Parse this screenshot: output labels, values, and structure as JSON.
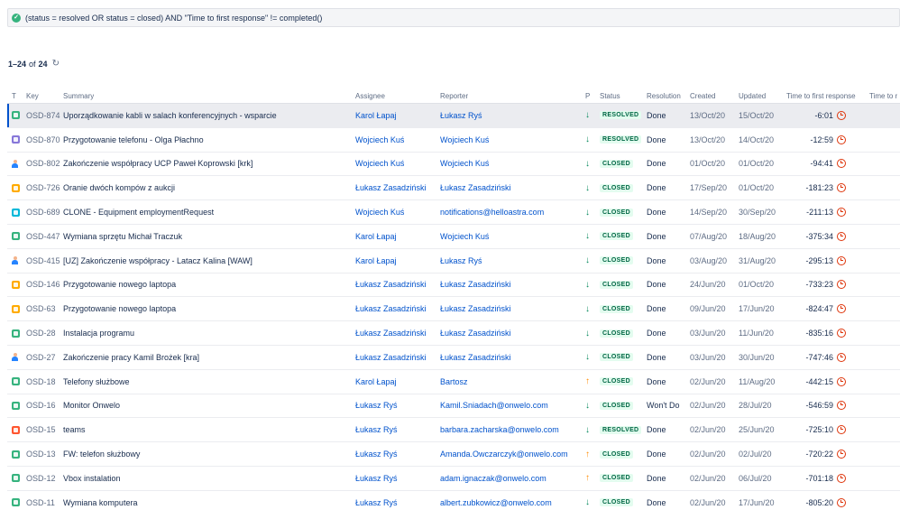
{
  "jql": {
    "query": "(status = resolved OR status = closed) AND \"Time to first response\" != completed()"
  },
  "results": {
    "range": "1–24",
    "of_label": "of",
    "total": "24"
  },
  "columns": [
    {
      "key": "t",
      "label": "T"
    },
    {
      "key": "key",
      "label": "Key"
    },
    {
      "key": "summary",
      "label": "Summary"
    },
    {
      "key": "assignee",
      "label": "Assignee"
    },
    {
      "key": "reporter",
      "label": "Reporter"
    },
    {
      "key": "p",
      "label": "P"
    },
    {
      "key": "status",
      "label": "Status"
    },
    {
      "key": "resolution",
      "label": "Resolution"
    },
    {
      "key": "created",
      "label": "Created"
    },
    {
      "key": "updated",
      "label": "Updated"
    },
    {
      "key": "ttfr",
      "label": "Time to first response"
    },
    {
      "key": "ttr",
      "label": "Time to r"
    }
  ],
  "colors": {
    "accent": "#0052cc",
    "resolved_bg": "#e3fcef",
    "resolved_text": "#006644",
    "priority_low": "#00875a",
    "priority_high": "#ff8b00",
    "sla_breached": "#de350b"
  },
  "rows": [
    {
      "type": "square",
      "type_color": "#36b37e",
      "key": "OSD-874",
      "summary": "Uporządkowanie kabli w salach konferencyjnych - wsparcie",
      "assignee": "Karol Łapaj",
      "reporter": "Łukasz Ryś",
      "priority": "low",
      "priority_glyph": "↓",
      "status": "RESOLVED",
      "resolution": "Done",
      "created": "13/Oct/20",
      "updated": "15/Oct/20",
      "ttfr": "-6:01"
    },
    {
      "type": "square",
      "type_color": "#8777d9",
      "key": "OSD-870",
      "summary": "Przygotowanie telefonu - Olga Płachno",
      "assignee": "Wojciech Kuś",
      "reporter": "Wojciech Kuś",
      "priority": "low",
      "priority_glyph": "↓",
      "status": "RESOLVED",
      "resolution": "Done",
      "created": "13/Oct/20",
      "updated": "14/Oct/20",
      "ttfr": "-12:59"
    },
    {
      "type": "person",
      "type_color": "#2684ff",
      "key": "OSD-802",
      "summary": "Zakończenie współpracy UCP Paweł Koprowski [krk]",
      "assignee": "Wojciech Kuś",
      "reporter": "Wojciech Kuś",
      "priority": "low",
      "priority_glyph": "↓",
      "status": "CLOSED",
      "resolution": "Done",
      "created": "01/Oct/20",
      "updated": "01/Oct/20",
      "ttfr": "-94:41"
    },
    {
      "type": "square",
      "type_color": "#ffab00",
      "key": "OSD-726",
      "summary": "Oranie dwóch kompów z aukcji",
      "assignee": "Łukasz Zasadziński",
      "reporter": "Łukasz Zasadziński",
      "priority": "low",
      "priority_glyph": "↓",
      "status": "CLOSED",
      "resolution": "Done",
      "created": "17/Sep/20",
      "updated": "01/Oct/20",
      "ttfr": "-181:23"
    },
    {
      "type": "square",
      "type_color": "#00b8d9",
      "key": "OSD-689",
      "summary": "CLONE - Equipment employmentRequest",
      "assignee": "Wojciech Kuś",
      "reporter": "notifications@helloastra.com",
      "priority": "low",
      "priority_glyph": "↓",
      "status": "CLOSED",
      "resolution": "Done",
      "created": "14/Sep/20",
      "updated": "30/Sep/20",
      "ttfr": "-211:13"
    },
    {
      "type": "square",
      "type_color": "#36b37e",
      "key": "OSD-447",
      "summary": "Wymiana sprzętu Michał Traczuk",
      "assignee": "Karol Łapaj",
      "reporter": "Wojciech Kuś",
      "priority": "low",
      "priority_glyph": "↓",
      "status": "CLOSED",
      "resolution": "Done",
      "created": "07/Aug/20",
      "updated": "18/Aug/20",
      "ttfr": "-375:34"
    },
    {
      "type": "person",
      "type_color": "#2684ff",
      "key": "OSD-415",
      "summary": "[UZ] Zakończenie współpracy - Latacz Kalina [WAW]",
      "assignee": "Karol Łapaj",
      "reporter": "Łukasz Ryś",
      "priority": "low",
      "priority_glyph": "↓",
      "status": "CLOSED",
      "resolution": "Done",
      "created": "03/Aug/20",
      "updated": "31/Aug/20",
      "ttfr": "-295:13"
    },
    {
      "type": "square",
      "type_color": "#ffab00",
      "key": "OSD-146",
      "summary": "Przygotowanie nowego laptopa",
      "assignee": "Łukasz Zasadziński",
      "reporter": "Łukasz Zasadziński",
      "priority": "low",
      "priority_glyph": "↓",
      "status": "CLOSED",
      "resolution": "Done",
      "created": "24/Jun/20",
      "updated": "01/Oct/20",
      "ttfr": "-733:23"
    },
    {
      "type": "square",
      "type_color": "#ffab00",
      "key": "OSD-63",
      "summary": "Przygotowanie nowego laptopa",
      "assignee": "Łukasz Zasadziński",
      "reporter": "Łukasz Zasadziński",
      "priority": "low",
      "priority_glyph": "↓",
      "status": "CLOSED",
      "resolution": "Done",
      "created": "09/Jun/20",
      "updated": "17/Jun/20",
      "ttfr": "-824:47"
    },
    {
      "type": "square",
      "type_color": "#36b37e",
      "key": "OSD-28",
      "summary": "Instalacja programu",
      "assignee": "Łukasz Zasadziński",
      "reporter": "Łukasz Zasadziński",
      "priority": "low",
      "priority_glyph": "↓",
      "status": "CLOSED",
      "resolution": "Done",
      "created": "03/Jun/20",
      "updated": "11/Jun/20",
      "ttfr": "-835:16"
    },
    {
      "type": "person",
      "type_color": "#2684ff",
      "key": "OSD-27",
      "summary": "Zakończenie pracy Kamil Brożek [kra]",
      "assignee": "Łukasz Zasadziński",
      "reporter": "Łukasz Zasadziński",
      "priority": "low",
      "priority_glyph": "↓",
      "status": "CLOSED",
      "resolution": "Done",
      "created": "03/Jun/20",
      "updated": "30/Jun/20",
      "ttfr": "-747:46"
    },
    {
      "type": "square",
      "type_color": "#36b37e",
      "key": "OSD-18",
      "summary": "Telefony służbowe",
      "assignee": "Karol Łapaj",
      "reporter": "Bartosz",
      "priority": "high",
      "priority_glyph": "↑",
      "status": "CLOSED",
      "resolution": "Done",
      "created": "02/Jun/20",
      "updated": "11/Aug/20",
      "ttfr": "-442:15"
    },
    {
      "type": "square",
      "type_color": "#36b37e",
      "key": "OSD-16",
      "summary": "Monitor Onwelo",
      "assignee": "Łukasz Ryś",
      "reporter": "Kamil.Sniadach@onwelo.com",
      "priority": "low",
      "priority_glyph": "↓",
      "status": "CLOSED",
      "resolution": "Won't Do",
      "created": "02/Jun/20",
      "updated": "28/Jul/20",
      "ttfr": "-546:59"
    },
    {
      "type": "square",
      "type_color": "#ff5630",
      "key": "OSD-15",
      "summary": "teams",
      "assignee": "Łukasz Ryś",
      "reporter": "barbara.zacharska@onwelo.com",
      "priority": "low",
      "priority_glyph": "↓",
      "status": "RESOLVED",
      "resolution": "Done",
      "created": "02/Jun/20",
      "updated": "25/Jun/20",
      "ttfr": "-725:10"
    },
    {
      "type": "square",
      "type_color": "#36b37e",
      "key": "OSD-13",
      "summary": "FW: telefon służbowy",
      "assignee": "Łukasz Ryś",
      "reporter": "Amanda.Owczarczyk@onwelo.com",
      "priority": "high",
      "priority_glyph": "↑",
      "status": "CLOSED",
      "resolution": "Done",
      "created": "02/Jun/20",
      "updated": "02/Jul/20",
      "ttfr": "-720:22"
    },
    {
      "type": "square",
      "type_color": "#36b37e",
      "key": "OSD-12",
      "summary": "Vbox instalation",
      "assignee": "Łukasz Ryś",
      "reporter": "adam.ignaczak@onwelo.com",
      "priority": "high",
      "priority_glyph": "↑",
      "status": "CLOSED",
      "resolution": "Done",
      "created": "02/Jun/20",
      "updated": "06/Jul/20",
      "ttfr": "-701:18"
    },
    {
      "type": "square",
      "type_color": "#36b37e",
      "key": "OSD-11",
      "summary": "Wymiana komputera",
      "assignee": "Łukasz Ryś",
      "reporter": "albert.zubkowicz@onwelo.com",
      "priority": "low",
      "priority_glyph": "↓",
      "status": "CLOSED",
      "resolution": "Done",
      "created": "02/Jun/20",
      "updated": "17/Jun/20",
      "ttfr": "-805:20"
    }
  ]
}
